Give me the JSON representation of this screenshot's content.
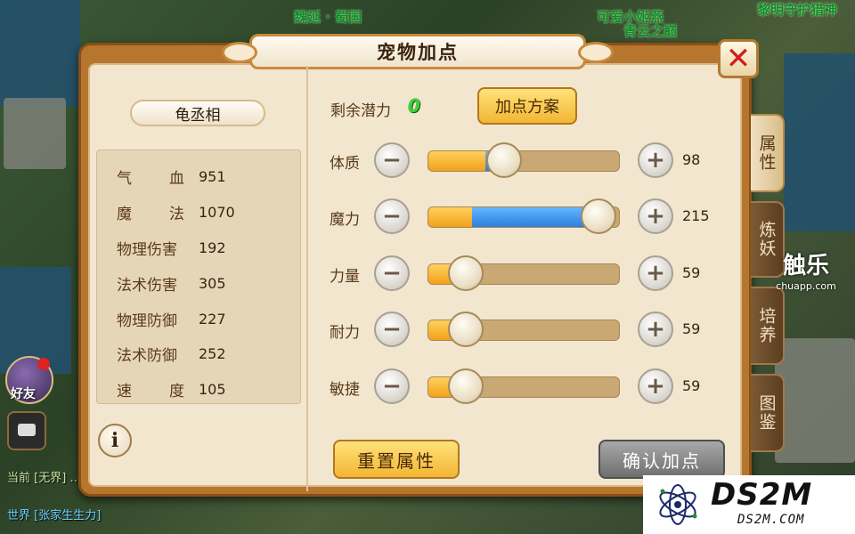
{
  "background": {
    "top_texts": [
      "魏延 · 蜀国",
      "可爱小姬燕",
      "黎明守护猎神",
      "青云之巅"
    ],
    "friend_label": "好友",
    "chat_line1": "当前 [无界] …",
    "chat_line2": "世界 [张家生生力]"
  },
  "dialog": {
    "title": "宠物加点",
    "close_glyph": "✕",
    "side_tabs": [
      "属性",
      "炼妖",
      "培养",
      "图鉴"
    ]
  },
  "pet": {
    "name": "龟丞相",
    "stats": [
      {
        "label": "气血",
        "value": "951",
        "spaced": true
      },
      {
        "label": "魔法",
        "value": "1070",
        "spaced": true
      },
      {
        "label": "物理伤害",
        "value": "192",
        "spaced": false
      },
      {
        "label": "法术伤害",
        "value": "305",
        "spaced": false
      },
      {
        "label": "物理防御",
        "value": "227",
        "spaced": false
      },
      {
        "label": "法术防御",
        "value": "252",
        "spaced": false
      },
      {
        "label": "速度",
        "value": "105",
        "spaced": true
      }
    ],
    "info_glyph": "i"
  },
  "points": {
    "potential_label": "剩余潜力",
    "potential_value": "0",
    "scheme_button": "加点方案",
    "attributes": [
      {
        "label": "体质",
        "value": "98",
        "base_fill": 0.3,
        "added_fill": 0.1
      },
      {
        "label": "魔力",
        "value": "215",
        "base_fill": 0.23,
        "added_fill": 0.66
      },
      {
        "label": "力量",
        "value": "59",
        "base_fill": 0.2,
        "added_fill": 0
      },
      {
        "label": "耐力",
        "value": "59",
        "base_fill": 0.2,
        "added_fill": 0
      },
      {
        "label": "敏捷",
        "value": "59",
        "base_fill": 0.2,
        "added_fill": 0
      }
    ],
    "minus_glyph": "−",
    "plus_glyph": "+",
    "reset_button": "重置属性",
    "confirm_button": "确认加点"
  },
  "watermarks": {
    "chuapp_big": "触乐",
    "chuapp_small": "chuapp.com",
    "ds2m_big": "DS2M",
    "ds2m_small": "DS2M.COM"
  },
  "colors": {
    "potential_green": "#3fd13a",
    "close_red": "#d31c1c",
    "fill_orange": "#f2a11a",
    "fill_blue": "#2b7fdc"
  }
}
